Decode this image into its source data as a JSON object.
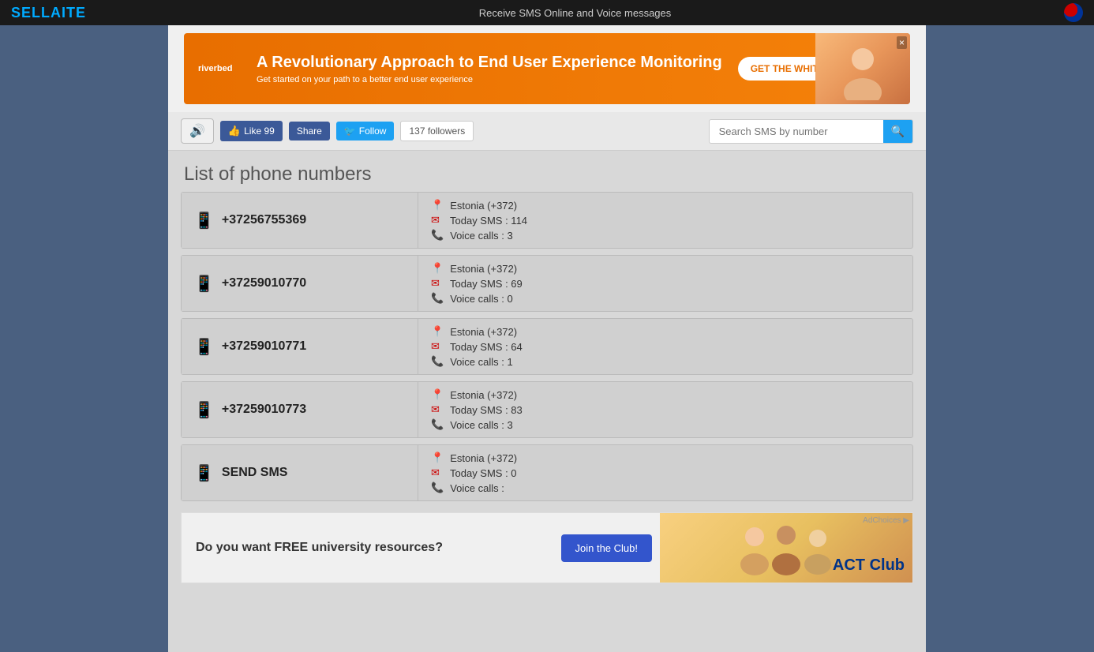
{
  "topbar": {
    "logo_main": "SELL",
    "logo_accent": "A",
    "logo_end": "ITE",
    "tagline": "Receive SMS Online and Voice messages",
    "flag_title": "Russian"
  },
  "ad_top": {
    "brand": "riverbed",
    "headline": "A Revolutionary Approach to End User Experience Monitoring",
    "subline": "Get started on your path to a  better end user experience",
    "cta": "GET THE WHITE PAPER",
    "close": "×"
  },
  "toolbar": {
    "sound_icon": "🔊",
    "like_label": "Like 99",
    "share_label": "Share",
    "follow_icon": "🐦",
    "follow_label": "Follow",
    "followers_count": "137 followers",
    "search_placeholder": "Search SMS by number",
    "search_icon": "🔍"
  },
  "page_title": "List of phone numbers",
  "phone_numbers": [
    {
      "number": "+37256755369",
      "country": "Estonia (+372)",
      "sms": "Today SMS : 114",
      "voice": "Voice calls : 3"
    },
    {
      "number": "+37259010770",
      "country": "Estonia (+372)",
      "sms": "Today SMS : 69",
      "voice": "Voice calls : 0"
    },
    {
      "number": "+37259010771",
      "country": "Estonia (+372)",
      "sms": "Today SMS : 64",
      "voice": "Voice calls : 1"
    },
    {
      "number": "+37259010773",
      "country": "Estonia (+372)",
      "sms": "Today SMS : 83",
      "voice": "Voice calls : 3"
    }
  ],
  "send_sms_card": {
    "label": "SEND SMS",
    "country": "Estonia (+372)",
    "sms": "Today SMS : 0",
    "voice": "Voice calls :"
  },
  "ad_bottom": {
    "choices": "AdChoices ▶",
    "headline": "Do you want FREE university resources?",
    "cta": "Join the Club!",
    "brand": "ACT Club"
  }
}
